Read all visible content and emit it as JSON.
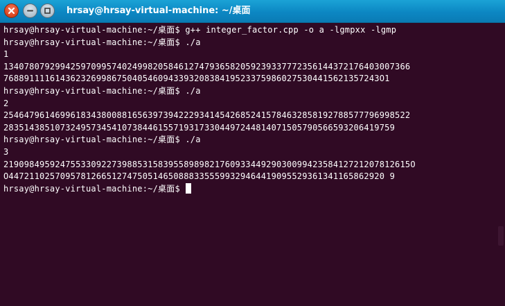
{
  "window": {
    "title": "hrsay@hrsay-virtual-machine: ~/桌面"
  },
  "terminal": {
    "lines": [
      "hrsay@hrsay-virtual-machine:~/桌面$ g++ integer_factor.cpp -o a -lgmpxx -lgmp",
      "hrsay@hrsay-virtual-machine:~/桌面$ ./a",
      "1",
      "1340780792994259709957402499820584612747936582059239337772356144372176403007366",
      "7688911116143623269986750405460943393208384195233759860275304415621357243O1",
      "hrsay@hrsay-virtual-machine:~/桌面$ ./a",
      "2",
      "2546479614699618343800881656397394222934145426852415784632858192788577796998522",
      "2835143851073249573454107384461557193173304497244814071505790566593206419759",
      "hrsay@hrsay-virtual-machine:~/桌面$ ./a",
      "3",
      "2190984959247553309227398853158395589898217609334492903009942358412721207812615O",
      "O4472110257095781266512747505146508883355599329464419095529361341165862920 9",
      "hrsay@hrsay-virtual-machine:~/桌面$ "
    ]
  },
  "colors": {
    "background": "#300a24",
    "text": "#ffffff",
    "titlebar": "#0c87c3"
  }
}
